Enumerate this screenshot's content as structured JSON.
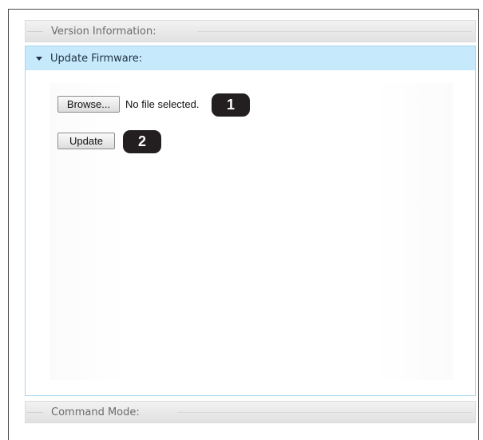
{
  "sections": {
    "version_information": {
      "label": "Version Information:"
    },
    "update_firmware": {
      "label": "Update Firmware:",
      "expanded_icon": "triangle-down"
    },
    "command_mode": {
      "label": "Command Mode:"
    }
  },
  "firmware_form": {
    "browse_label": "Browse...",
    "file_status": "No file selected.",
    "update_label": "Update"
  },
  "callouts": [
    "1",
    "2"
  ],
  "colors": {
    "expanded_header_bg": "#c6e9fb",
    "callout_bg": "#231f20"
  }
}
